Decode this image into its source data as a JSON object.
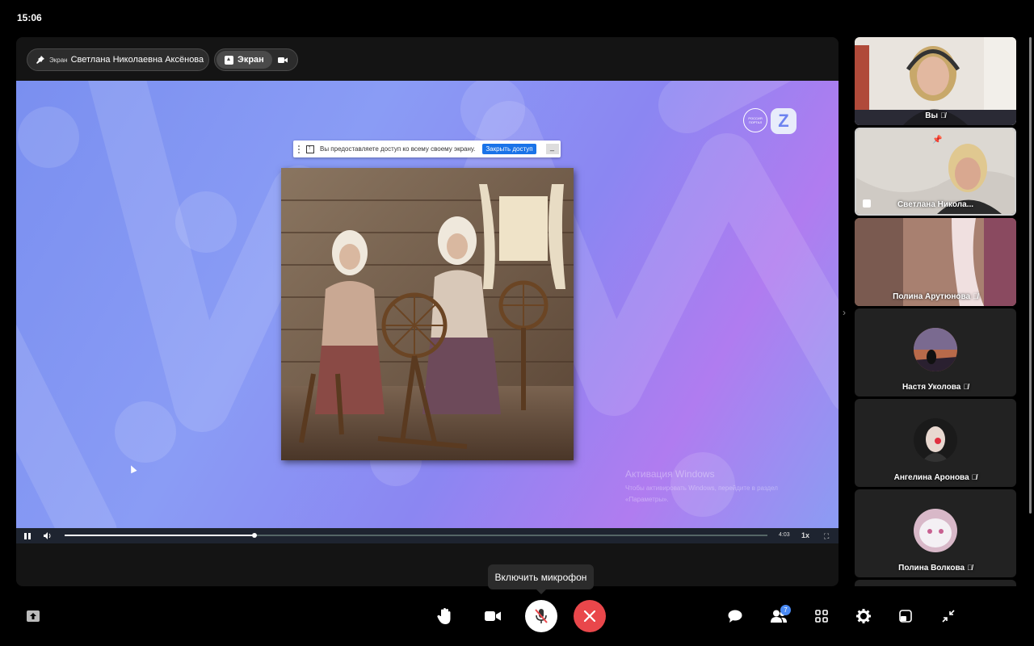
{
  "status": {
    "time": "15:06"
  },
  "stage": {
    "presenter_tag": "Экран",
    "presenter_name": "Светлана Николаевна Аксёнова",
    "screen_chip_label": "Экран"
  },
  "share_bar": {
    "message": "Вы предоставляете доступ ко всему своему экрану.",
    "stop_label": "Закрыть доступ",
    "hide_label": "_"
  },
  "logo": {
    "circle_text": "РОССИЯ ПОРТАЛ",
    "z_letter": "Z"
  },
  "watermark": {
    "title": "Активация Windows",
    "text": "Чтобы активировать Windows, перейдите в раздел «Параметры»."
  },
  "player": {
    "time": "4:03",
    "speed": "1x",
    "progress": 0.27
  },
  "participants": [
    {
      "name": "Вы",
      "mic_off": true,
      "kind": "video-self"
    },
    {
      "name": "Светлана Никола...",
      "mic_off": false,
      "kind": "video-pinned"
    },
    {
      "name": "Полина Арутюнова",
      "mic_off": true,
      "kind": "video-room"
    },
    {
      "name": "Настя Уколова",
      "mic_off": true,
      "kind": "avatar"
    },
    {
      "name": "Ангелина Аронова",
      "mic_off": true,
      "kind": "avatar"
    },
    {
      "name": "Полина Волкова",
      "mic_off": true,
      "kind": "avatar"
    }
  ],
  "toolbar": {
    "tooltip": "Включить микрофон",
    "participants_count": "7",
    "icons": [
      "share-screen-icon",
      "raise-hand-icon",
      "camera-icon",
      "mic-muted-icon",
      "hang-up-icon",
      "chat-icon",
      "participants-icon",
      "grid-icon",
      "settings-icon",
      "layout-icon",
      "minimize-icon"
    ]
  },
  "colors": {
    "accent": "#1a73e8",
    "hangup": "#e9474b",
    "stage_bg": "#141414",
    "share_bg": "#8a9cf5"
  }
}
